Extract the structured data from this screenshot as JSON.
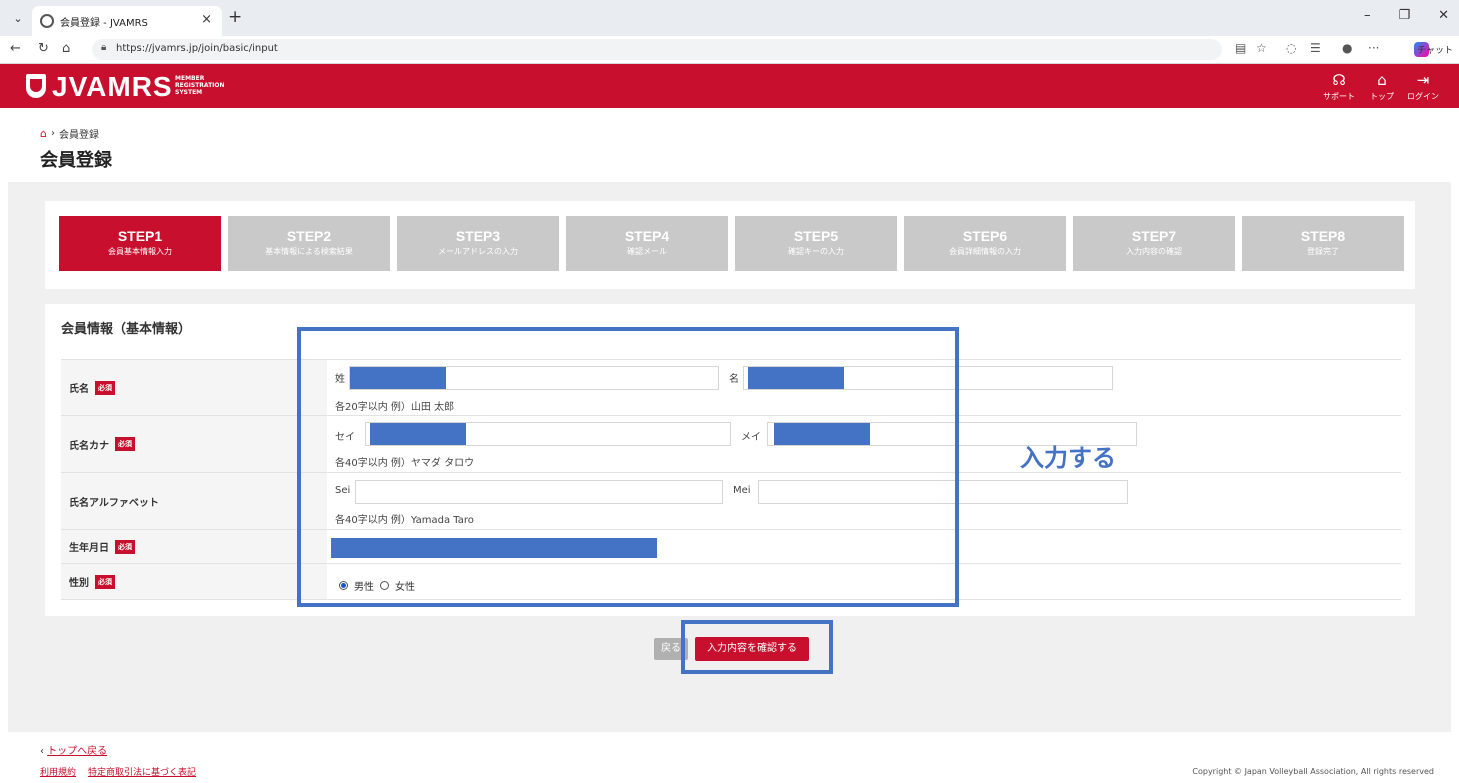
{
  "browser": {
    "tab_title": "会員登録 - JVAMRS",
    "url": "https://jvamrs.jp/join/basic/input",
    "chat_label": "チャット"
  },
  "header": {
    "logo_text": "JVAMRS",
    "logo_sub": [
      "MEMBER",
      "REGISTRATION",
      "SYSTEM"
    ],
    "links": [
      {
        "label": "サポート",
        "icon": "support-icon"
      },
      {
        "label": "トップ",
        "icon": "home-icon"
      },
      {
        "label": "ログイン",
        "icon": "login-icon"
      }
    ],
    "brand_color": "#c8102e"
  },
  "breadcrumb": {
    "current": "会員登録"
  },
  "page_title": "会員登録",
  "steps": [
    {
      "num": "STEP1",
      "label": "会員基本情報入力",
      "active": true
    },
    {
      "num": "STEP2",
      "label": "基本情報による検索結果",
      "active": false
    },
    {
      "num": "STEP3",
      "label": "メールアドレスの入力",
      "active": false
    },
    {
      "num": "STEP4",
      "label": "確認メール",
      "active": false
    },
    {
      "num": "STEP5",
      "label": "確認キーの入力",
      "active": false
    },
    {
      "num": "STEP6",
      "label": "会員詳細情報の入力",
      "active": false
    },
    {
      "num": "STEP7",
      "label": "入力内容の確認",
      "active": false
    },
    {
      "num": "STEP8",
      "label": "登録完了",
      "active": false
    }
  ],
  "form": {
    "section_title": "会員情報（基本情報）",
    "required_badge": "必須",
    "name": {
      "label": "氏名",
      "sei": "姓",
      "mei": "名",
      "hint": "各20字以内 例）山田 太郎"
    },
    "kana": {
      "label": "氏名カナ",
      "sei": "セイ",
      "mei": "メイ",
      "hint": "各40字以内 例）ヤマダ タロウ"
    },
    "alpha": {
      "label": "氏名アルファベット",
      "sei": "Sei",
      "mei": "Mei",
      "hint": "各40字以内 例）Yamada Taro"
    },
    "birth": {
      "label": "生年月日"
    },
    "gender": {
      "label": "性別",
      "options": [
        "男性",
        "女性"
      ],
      "selected": "男性"
    }
  },
  "annotation": {
    "text": "入力する",
    "color": "#4472c4"
  },
  "buttons": {
    "back": "戻る",
    "confirm": "入力内容を確認する"
  },
  "footer": {
    "back_link": "トップへ戻る",
    "links": [
      "利用規約",
      "特定商取引法に基づく表記"
    ],
    "copyright": "Copyright © Japan Volleyball Association, All rights reserved"
  }
}
